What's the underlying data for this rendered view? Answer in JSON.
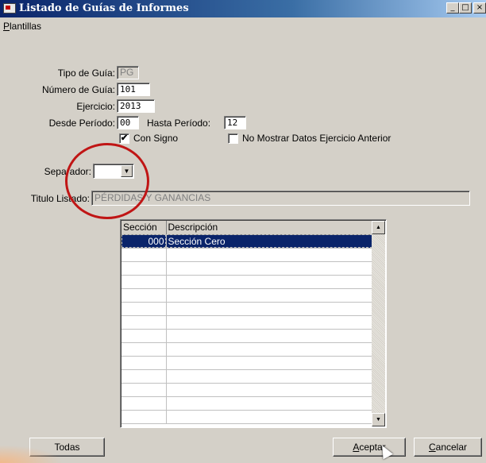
{
  "window": {
    "title": "Listado de Guías de Informes"
  },
  "titlebar_buttons": {
    "minimize": "_",
    "maximize": "□",
    "close": "×"
  },
  "menu": {
    "plantillas": "Plantillas"
  },
  "form": {
    "tipo_guia": {
      "label": "Tipo de Guía:",
      "value": "PG"
    },
    "numero_guia": {
      "label": "Número de Guía:",
      "value": "101"
    },
    "ejercicio": {
      "label": "Ejercicio:",
      "value": "2013"
    },
    "desde_periodo": {
      "label": "Desde Período:",
      "value": "00"
    },
    "hasta_periodo": {
      "label": "Hasta Período:",
      "value": "12"
    },
    "con_signo": {
      "label": "Con Signo",
      "checked": true,
      "mark": "✔"
    },
    "no_mostrar": {
      "label": "No Mostrar Datos Ejercicio Anterior",
      "checked": false,
      "mark": ""
    },
    "separador": {
      "label": "Separador:",
      "value": "",
      "arrow": "▼"
    },
    "titulo_listado": {
      "label": "Titulo Listado:",
      "value": "PÉRDIDAS Y GANANCIAS"
    }
  },
  "grid": {
    "columns": [
      "Sección",
      "Descripción"
    ],
    "rows": [
      {
        "code": "000",
        "desc": "Sección Cero"
      },
      {
        "code": "",
        "desc": ""
      },
      {
        "code": "",
        "desc": ""
      },
      {
        "code": "",
        "desc": ""
      },
      {
        "code": "",
        "desc": ""
      },
      {
        "code": "",
        "desc": ""
      },
      {
        "code": "",
        "desc": ""
      },
      {
        "code": "",
        "desc": ""
      },
      {
        "code": "",
        "desc": ""
      },
      {
        "code": "",
        "desc": ""
      },
      {
        "code": "",
        "desc": ""
      },
      {
        "code": "",
        "desc": ""
      },
      {
        "code": "",
        "desc": ""
      },
      {
        "code": "",
        "desc": ""
      }
    ],
    "scroll_up": "▲",
    "scroll_down": "▼"
  },
  "buttons": {
    "todas": "Todas",
    "aceptar": "Aceptar",
    "cancelar": "Cancelar"
  },
  "colors": {
    "titlebar": "#0a246a",
    "selection": "#0a246a",
    "annotation": "#c01515",
    "window_bg": "#d4d0c8"
  }
}
